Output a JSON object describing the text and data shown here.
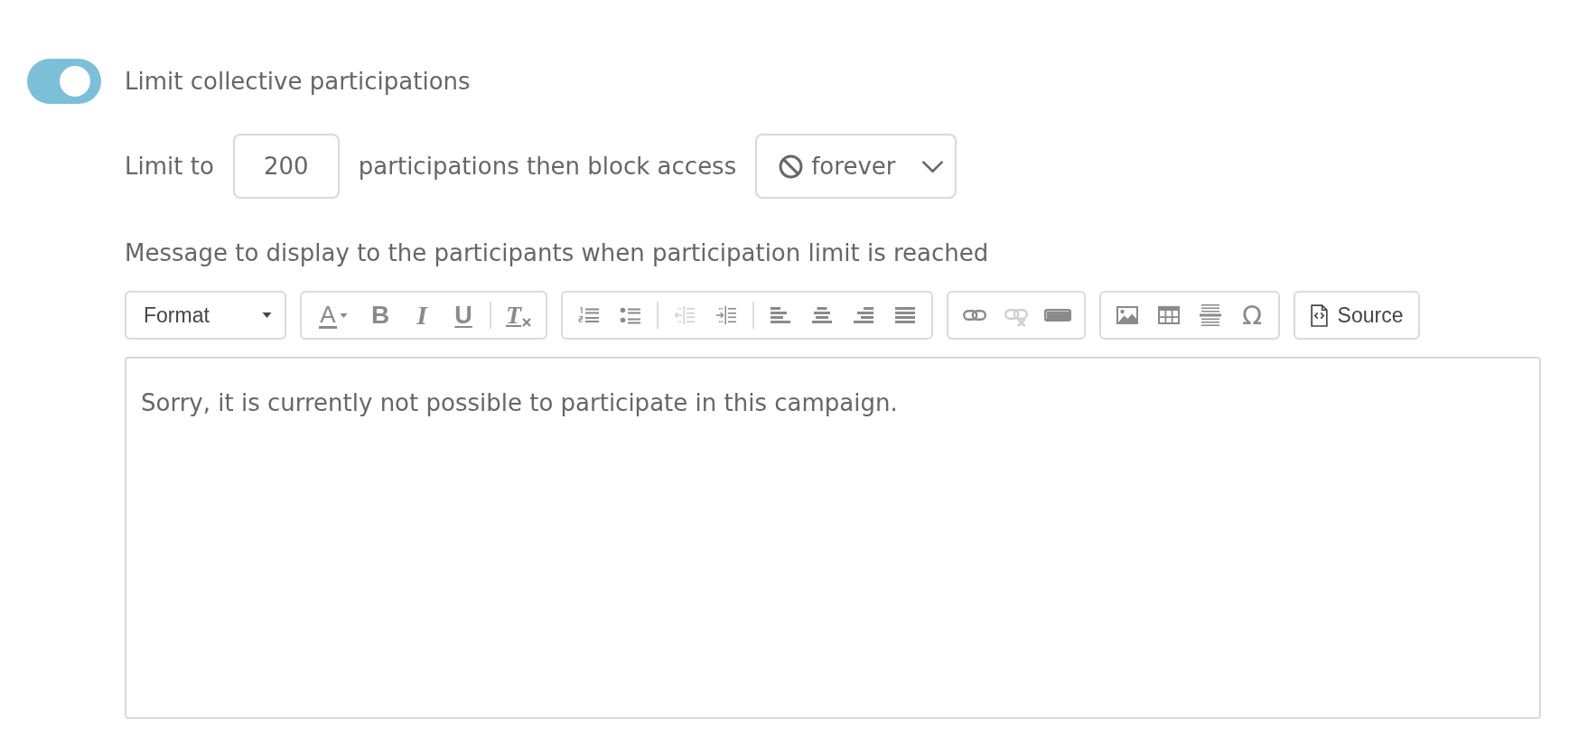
{
  "limit_toggle": {
    "label": "Limit collective participations",
    "on": true
  },
  "limit_row": {
    "prefix": "Limit to",
    "count_input": {
      "value": "200"
    },
    "suffix": "participations then block access",
    "duration_select": {
      "value": "forever"
    }
  },
  "message": {
    "label": "Message to display to the participants when participation limit is reached",
    "toolbar": {
      "groups": [
        {
          "items": [
            {
              "kind": "combo",
              "label": "Format",
              "disabled": false
            }
          ]
        },
        {
          "items": [
            {
              "kind": "text-color",
              "label": "A",
              "disabled": false
            },
            {
              "kind": "bold",
              "label": "B",
              "disabled": false
            },
            {
              "kind": "italic",
              "label": "I",
              "disabled": false
            },
            {
              "kind": "underline",
              "label": "U",
              "disabled": false
            },
            {
              "kind": "separator"
            },
            {
              "kind": "remove-format",
              "label": "T",
              "disabled": false
            }
          ]
        },
        {
          "items": [
            {
              "kind": "numbered-list",
              "disabled": false
            },
            {
              "kind": "bulleted-list",
              "disabled": false
            },
            {
              "kind": "separator"
            },
            {
              "kind": "outdent",
              "disabled": true
            },
            {
              "kind": "indent",
              "disabled": false
            },
            {
              "kind": "separator"
            },
            {
              "kind": "align-left",
              "disabled": false
            },
            {
              "kind": "align-center",
              "disabled": false
            },
            {
              "kind": "align-right",
              "disabled": false
            },
            {
              "kind": "justify",
              "disabled": false
            }
          ]
        },
        {
          "items": [
            {
              "kind": "link",
              "disabled": false
            },
            {
              "kind": "unlink",
              "disabled": true
            },
            {
              "kind": "block",
              "disabled": false
            }
          ]
        },
        {
          "items": [
            {
              "kind": "image",
              "disabled": false
            },
            {
              "kind": "table",
              "disabled": false
            },
            {
              "kind": "horizontal-rule",
              "disabled": false
            },
            {
              "kind": "special-char",
              "label": "Ω",
              "disabled": false
            }
          ]
        },
        {
          "items": [
            {
              "kind": "source",
              "label": "Source",
              "disabled": false
            }
          ]
        }
      ]
    },
    "editor": {
      "content": "Sorry, it is currently not possible to participate in this campaign."
    }
  }
}
